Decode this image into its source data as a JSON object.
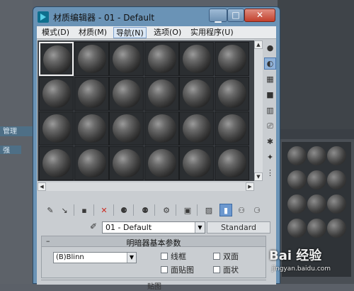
{
  "window": {
    "title": "材质编辑器 - 01 - Default"
  },
  "menu": {
    "items": [
      {
        "label": "模式(D)"
      },
      {
        "label": "材质(M)"
      },
      {
        "label": "导航(N)"
      },
      {
        "label": "选项(O)"
      },
      {
        "label": "实用程序(U)"
      }
    ],
    "active_index": 2
  },
  "sample_slots": {
    "rows": 4,
    "cols": 6,
    "selected_index": 0
  },
  "material": {
    "name": "01 - Default",
    "type_button": "Standard"
  },
  "shader_rollout": {
    "title": "明暗器基本参数",
    "shader_value": "(B)Blinn",
    "options": [
      {
        "label": "线框",
        "checked": false
      },
      {
        "label": "双面",
        "checked": false
      },
      {
        "label": "面贴图",
        "checked": false
      },
      {
        "label": "面状",
        "checked": false
      }
    ]
  },
  "next_rollout": {
    "title": "贴图"
  },
  "background": {
    "panel_title": "",
    "watermark": "Bai 经验",
    "watermark_url": "jingyan.baidu.com"
  },
  "icons": {
    "app": "3dsmax-icon",
    "close": "close-icon"
  }
}
